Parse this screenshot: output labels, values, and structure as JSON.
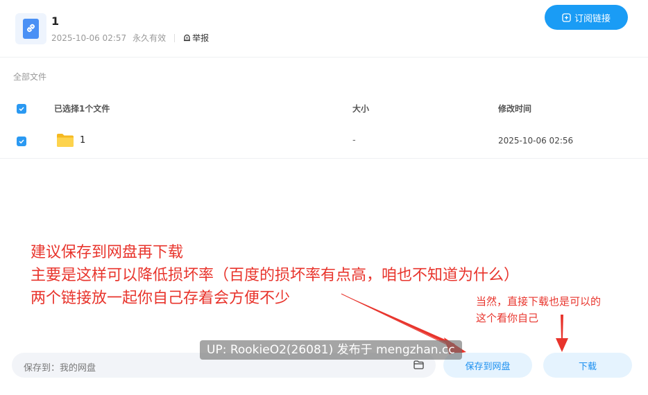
{
  "header": {
    "title": "1",
    "date": "2025-10-06 02:57",
    "validity": "永久有效",
    "report_label": "举报",
    "subscribe_label": "订阅链接"
  },
  "breadcrumb": "全部文件",
  "table": {
    "select_all_checked": true,
    "columns": {
      "name": "已选择1个文件",
      "size": "大小",
      "modified": "修改时间"
    },
    "rows": [
      {
        "checked": true,
        "icon": "folder-icon",
        "name": "1",
        "size": "-",
        "modified": "2025-10-06 02:56"
      }
    ]
  },
  "annotations": {
    "main_lines": [
      "建议保存到网盘再下载",
      "主要是这样可以降低损坏率（百度的损坏率有点高，咱也不知道为什么）",
      "两个链接放一起你自己存着会方便不少"
    ],
    "side_lines": [
      "当然，直接下载也是可以的",
      "这个看你自己"
    ],
    "color": "#e8342c"
  },
  "bottom": {
    "save_path_label": "保存到：我的网盘",
    "save_button": "保存到网盘",
    "download_button": "下载"
  },
  "watermark": "UP: RookieO2(26081) 发布于 mengzhan.cc",
  "colors": {
    "accent": "#1a9cf5",
    "checkbox": "#2a99f2",
    "button_bg": "#e5f3fe"
  }
}
